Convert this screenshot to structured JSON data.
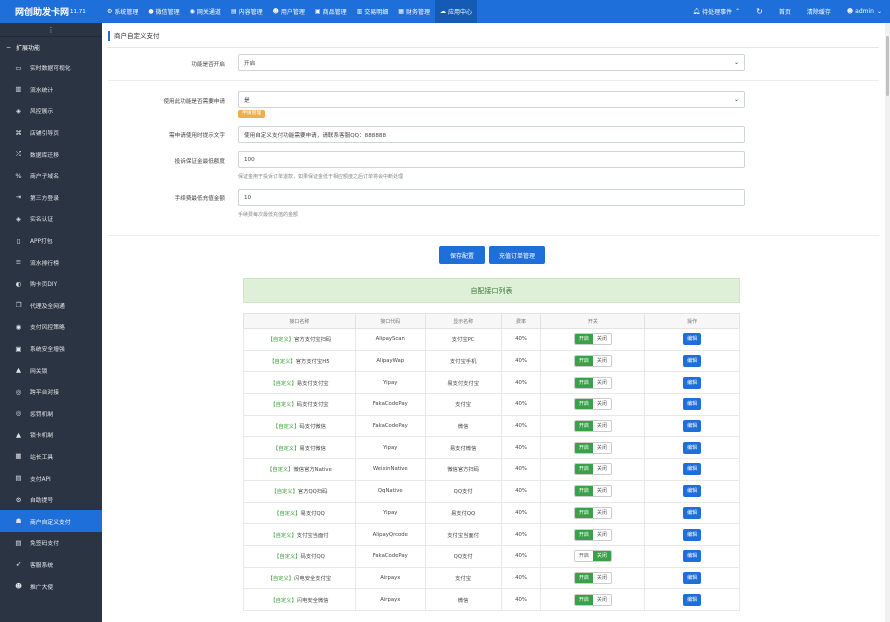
{
  "app": {
    "name": "网创助发卡网",
    "version": "11.71"
  },
  "topnav": [
    {
      "label": "系统管理",
      "icon": "gear-icon",
      "glyph": "⚙"
    },
    {
      "label": "微信管理",
      "icon": "chat-icon",
      "glyph": "●"
    },
    {
      "label": "网关通道",
      "icon": "globe-icon",
      "glyph": "◉"
    },
    {
      "label": "内容管理",
      "icon": "file-icon",
      "glyph": "▤"
    },
    {
      "label": "用户管理",
      "icon": "users-icon",
      "glyph": "☻"
    },
    {
      "label": "商品管理",
      "icon": "box-icon",
      "glyph": "▣"
    },
    {
      "label": "交易明细",
      "icon": "chart-icon",
      "glyph": "▥"
    },
    {
      "label": "财务管理",
      "icon": "bank-icon",
      "glyph": "▦"
    },
    {
      "label": "应用中心",
      "icon": "cloud-icon",
      "glyph": "☁",
      "active": true
    }
  ],
  "topright": {
    "pending": "待处理事件",
    "refresh_glyph": "↻",
    "home": "首页",
    "clear_cache": "清除缓存",
    "user": "admin"
  },
  "sidebar": {
    "toggle_glyph": "⋮",
    "group": "扩展功能",
    "items": [
      {
        "label": "实时数据可视化",
        "glyph": "▭"
      },
      {
        "label": "流水统计",
        "glyph": "▥"
      },
      {
        "label": "风控展示",
        "glyph": "◈"
      },
      {
        "label": "店铺引导页",
        "glyph": "⌘"
      },
      {
        "label": "数据库迁移",
        "glyph": "⤮"
      },
      {
        "label": "商户子域名",
        "glyph": "%"
      },
      {
        "label": "第三方登录",
        "glyph": "⇥"
      },
      {
        "label": "实名认证",
        "glyph": "◈"
      },
      {
        "label": "APP打包",
        "glyph": "▯"
      },
      {
        "label": "流水排行榜",
        "glyph": "≡"
      },
      {
        "label": "购卡页DIY",
        "glyph": "◐"
      },
      {
        "label": "代理及全网通",
        "glyph": "❐"
      },
      {
        "label": "支付风控策略",
        "glyph": "◉"
      },
      {
        "label": "系统安全增强",
        "glyph": "▣"
      },
      {
        "label": "网关锁",
        "glyph": "▲"
      },
      {
        "label": "跨平台对接",
        "glyph": "◎"
      },
      {
        "label": "惩罚机制",
        "glyph": "◎"
      },
      {
        "label": "锁卡机制",
        "glyph": "▲"
      },
      {
        "label": "站长工具",
        "glyph": "▦"
      },
      {
        "label": "支付API",
        "glyph": "▤"
      },
      {
        "label": "自助提号",
        "glyph": "⚙"
      },
      {
        "label": "商户自定义支付",
        "glyph": "☗",
        "active": true
      },
      {
        "label": "免签码支付",
        "glyph": "▤"
      },
      {
        "label": "客服系统",
        "glyph": "➶"
      },
      {
        "label": "推广大使",
        "glyph": "☻"
      }
    ]
  },
  "page": {
    "title": "商户自定义支付"
  },
  "form": {
    "enabled_label": "功能是否开启",
    "enabled_value": "开启",
    "need_apply_label": "使用此功能是否需要申请",
    "need_apply_value": "是",
    "apply_badge": "申请管理",
    "apply_tip_label": "需申请使用时提示文字",
    "apply_tip_value": "使用自定义支付功能需要申请，请联系客服QQ：888888",
    "deposit_label": "投诉保证金最低额度",
    "deposit_value": "100",
    "deposit_help": "保证金用于投诉订单退款，如果保证金低于相应额度之后订单将会中断处理",
    "fee_label": "手续费最低充值金额",
    "fee_value": "10",
    "fee_help": "手续费每次最低充值的金额",
    "caret": "⌄"
  },
  "buttons": {
    "save": "保存配置",
    "recharge": "充值订单管理"
  },
  "list": {
    "heading": "自配接口列表",
    "columns": [
      "接口名称",
      "接口代码",
      "显示名称",
      "费率",
      "开关",
      "操作"
    ],
    "on_label": "开启",
    "off_label": "关闭",
    "edit_label": "编辑",
    "rows": [
      {
        "tag": "【自定义】",
        "name": "官方支付宝扫码",
        "code": "AlipayScan",
        "display": "支付宝PC",
        "rate": "40%",
        "enabled": true
      },
      {
        "tag": "【自定义】",
        "name": "官方支付宝H5",
        "code": "AlipayWap",
        "display": "支付宝手机",
        "rate": "40%",
        "enabled": true
      },
      {
        "tag": "【自定义】",
        "name": "易支付支付宝",
        "code": "Yipay",
        "display": "易支付支付宝",
        "rate": "40%",
        "enabled": true
      },
      {
        "tag": "【自定义】",
        "name": "码支付支付宝",
        "code": "FakaCodePay",
        "display": "支付宝",
        "rate": "40%",
        "enabled": true
      },
      {
        "tag": "【自定义】",
        "name": "码支付微信",
        "code": "FakaCodePay",
        "display": "微信",
        "rate": "40%",
        "enabled": true
      },
      {
        "tag": "【自定义】",
        "name": "易支付微信",
        "code": "Yipay",
        "display": "易支付微信",
        "rate": "40%",
        "enabled": true
      },
      {
        "tag": "【自定义】",
        "name": "微信官方Native",
        "code": "WeixinNative",
        "display": "微信官方扫码",
        "rate": "40%",
        "enabled": true
      },
      {
        "tag": "【自定义】",
        "name": "官方QQ扫码",
        "code": "QqNative",
        "display": "QQ支付",
        "rate": "40%",
        "enabled": true
      },
      {
        "tag": "【自定义】",
        "name": "易支付QQ",
        "code": "Yipay",
        "display": "易支付QQ",
        "rate": "40%",
        "enabled": true
      },
      {
        "tag": "【自定义】",
        "name": "支付宝当面付",
        "code": "AlipayQrcode",
        "display": "支付宝当面付",
        "rate": "40%",
        "enabled": true
      },
      {
        "tag": "【自定义】",
        "name": "码支付QQ",
        "code": "FakaCodePay",
        "display": "QQ支付",
        "rate": "40%",
        "enabled": false
      },
      {
        "tag": "【自定义】",
        "name": "闪电安全支付宝",
        "code": "Airpayx",
        "display": "支付宝",
        "rate": "40%",
        "enabled": true
      },
      {
        "tag": "【自定义】",
        "name": "闪电安全微信",
        "code": "Airpayx",
        "display": "微信",
        "rate": "40%",
        "enabled": true
      }
    ]
  }
}
